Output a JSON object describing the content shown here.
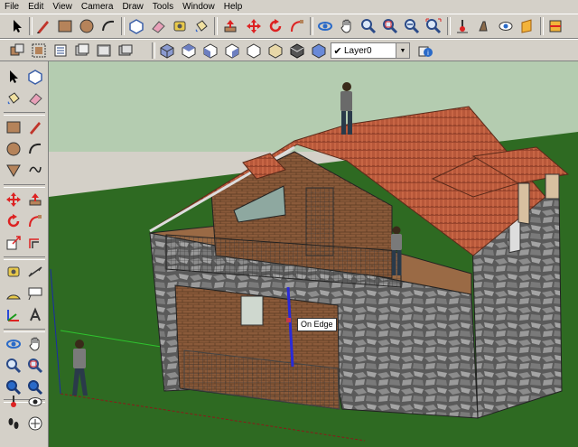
{
  "menu": [
    "File",
    "Edit",
    "View",
    "Camera",
    "Draw",
    "Tools",
    "Window",
    "Help"
  ],
  "layer": {
    "check": "✔",
    "name": "Layer0"
  },
  "viewport": {
    "tooltip": "On Edge",
    "sky_color": "#b4ccb0",
    "ground_color": "#2e6a22"
  },
  "toolbar_top": [
    "select-tool",
    "pencil-tool",
    "rectangle-tool",
    "circle-tool",
    "arc-tool",
    "push-pull-tool",
    "eraser-tool",
    "paint-bucket-tool",
    "move-tool",
    "rotate-tool",
    "follow-me-tool",
    "orbit-tool",
    "pan-tool",
    "zoom-tool",
    "zoom-window-tool",
    "zoom-extents-tool",
    "previous-view-tool",
    "next-view-tool",
    "position-camera-tool",
    "walk-tool",
    "look-around-tool",
    "section-plane-tool"
  ],
  "toolbar_views": [
    "components-icon",
    "groups-icon",
    "outliner-icon",
    "layers-icon",
    "iso-view-icon",
    "top-view-icon",
    "front-view-icon",
    "right-view-icon",
    "back-view-icon",
    "left-view-icon",
    "wireframe-style-icon",
    "shaded-style-icon",
    "textured-style-icon",
    "monochrome-style-icon",
    "layer-manager-icon"
  ]
}
